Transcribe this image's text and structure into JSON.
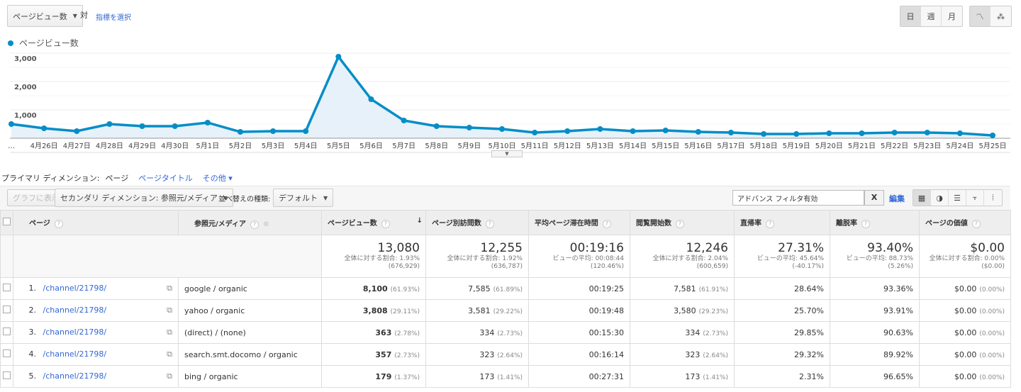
{
  "top": {
    "metric_select": "ページビュー数",
    "vs": "対",
    "select_metric_link": "指標を選択",
    "period_buttons": [
      "日",
      "週",
      "月"
    ]
  },
  "chart_data": {
    "type": "line",
    "series": [
      {
        "name": "ページビュー数",
        "color": "#058dc7",
        "values": [
          500,
          350,
          250,
          500,
          425,
          425,
          550,
          225,
          250,
          250,
          2875,
          1375,
          625,
          425,
          375,
          325,
          200,
          250,
          325,
          250,
          275,
          225,
          200,
          150,
          150,
          175,
          175,
          200,
          200,
          175,
          100
        ]
      }
    ],
    "x": [
      "…",
      "4月26日",
      "4月27日",
      "4月28日",
      "4月29日",
      "4月30日",
      "5月1日",
      "5月2日",
      "5月3日",
      "5月4日",
      "5月5日",
      "5月6日",
      "5月7日",
      "5月8日",
      "5月9日",
      "5月10日",
      "5月11日",
      "5月12日",
      "5月13日",
      "5月14日",
      "5月15日",
      "5月16日",
      "5月17日",
      "5月18日",
      "5月19日",
      "5月20日",
      "5月21日",
      "5月22日",
      "5月23日",
      "5月24日",
      "5月25日"
    ],
    "yticks": [
      "1,000",
      "2,000",
      "3,000"
    ],
    "ylim": [
      0,
      3000
    ]
  },
  "dims": {
    "label": "プライマリ ディメンション:",
    "current": "ページ",
    "other": "ページタイトル",
    "more": "その他"
  },
  "toolbar": {
    "graph": "グラフに表示",
    "secondary": "セカンダリ ディメンション: 参照元/メディア",
    "sort_label": "並べ替えの種類:",
    "sort_value": "デフォルト",
    "filter": "アドバンス フィルタ有効",
    "clear": "X",
    "edit": "編集"
  },
  "columns": [
    "ページ",
    "参照元/メディア",
    "ページビュー数",
    "ページ別訪問数",
    "平均ページ滞在時間",
    "閲覧開始数",
    "直帰率",
    "離脱率",
    "ページの価値"
  ],
  "totals": [
    {
      "v": "13,080",
      "s1": "全体に対する割合: 1.93%",
      "s2": "(676,929)"
    },
    {
      "v": "12,255",
      "s1": "全体に対する割合: 1.92%",
      "s2": "(636,787)"
    },
    {
      "v": "00:19:16",
      "s1": "ビューの平均: 00:08:44",
      "s2": "(120.46%)"
    },
    {
      "v": "12,246",
      "s1": "全体に対する割合: 2.04%",
      "s2": "(600,659)"
    },
    {
      "v": "27.31%",
      "s1": "ビューの平均: 45.64%",
      "s2": "(-40.17%)"
    },
    {
      "v": "93.40%",
      "s1": "ビューの平均: 88.73%",
      "s2": "(5.26%)"
    },
    {
      "v": "$0.00",
      "s1": "全体に対する割合: 0.00%",
      "s2": "($0.00)"
    }
  ],
  "rows": [
    {
      "n": "1.",
      "page": "/channel/21798/",
      "src": "google / organic",
      "pv": "8,100",
      "pvp": "(61.93%)",
      "uv": "7,585",
      "uvp": "(61.89%)",
      "t": "00:19:25",
      "e": "7,581",
      "ep": "(61.91%)",
      "b": "28.64%",
      "x": "93.36%",
      "val": "$0.00",
      "valp": "(0.00%)"
    },
    {
      "n": "2.",
      "page": "/channel/21798/",
      "src": "yahoo / organic",
      "pv": "3,808",
      "pvp": "(29.11%)",
      "uv": "3,581",
      "uvp": "(29.22%)",
      "t": "00:19:48",
      "e": "3,580",
      "ep": "(29.23%)",
      "b": "25.70%",
      "x": "93.91%",
      "val": "$0.00",
      "valp": "(0.00%)"
    },
    {
      "n": "3.",
      "page": "/channel/21798/",
      "src": "(direct) / (none)",
      "pv": "363",
      "pvp": "(2.78%)",
      "uv": "334",
      "uvp": "(2.73%)",
      "t": "00:15:30",
      "e": "334",
      "ep": "(2.73%)",
      "b": "29.85%",
      "x": "90.63%",
      "val": "$0.00",
      "valp": "(0.00%)"
    },
    {
      "n": "4.",
      "page": "/channel/21798/",
      "src": "search.smt.docomo / organic",
      "pv": "357",
      "pvp": "(2.73%)",
      "uv": "323",
      "uvp": "(2.64%)",
      "t": "00:16:14",
      "e": "323",
      "ep": "(2.64%)",
      "b": "29.32%",
      "x": "89.92%",
      "val": "$0.00",
      "valp": "(0.00%)"
    },
    {
      "n": "5.",
      "page": "/channel/21798/",
      "src": "bing / organic",
      "pv": "179",
      "pvp": "(1.37%)",
      "uv": "173",
      "uvp": "(1.41%)",
      "t": "00:27:31",
      "e": "173",
      "ep": "(1.41%)",
      "b": "2.31%",
      "x": "96.65%",
      "val": "$0.00",
      "valp": "(0.00%)"
    }
  ]
}
